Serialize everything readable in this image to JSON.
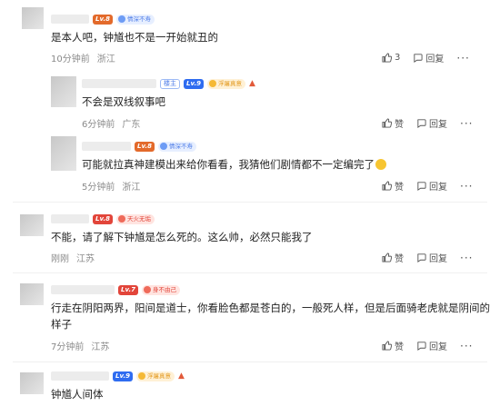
{
  "comments": [
    {
      "level": "Lv.8",
      "badge": "情深不寿",
      "text": "是本人吧，钟馗也不是一开始就丑的",
      "time": "10分钟前",
      "location": "浙江",
      "likes": "3",
      "reply_label": "回复"
    },
    {
      "host_tag": "楼主",
      "level": "Lv.9",
      "badge": "浮屠真意",
      "text": "不会是双线叙事吧",
      "time": "6分钟前",
      "location": "广东",
      "like_label": "赞",
      "reply_label": "回复"
    },
    {
      "level": "Lv.8",
      "badge": "情深不寿",
      "text": "可能就拉真神建模出来给你看看，我猜他们剧情都不一定编完了",
      "time": "5分钟前",
      "location": "浙江",
      "like_label": "赞",
      "reply_label": "回复"
    },
    {
      "level": "Lv.8",
      "badge": "天火无垢",
      "text": "不能，请了解下钟馗是怎么死的。这么帅，必然只能我了",
      "time": "刚刚",
      "location": "江苏",
      "like_label": "赞",
      "reply_label": "回复"
    },
    {
      "level": "Lv.7",
      "badge": "身不由己",
      "text_line1": "行走在阴阳两界，阳间是道士，你看脸色都是苍白的，一般死人样，但是后面骑老虎就是阴间的",
      "text_line2": "样子",
      "time": "7分钟前",
      "location": "江苏",
      "like_label": "赞",
      "reply_label": "回复"
    },
    {
      "level": "Lv.9",
      "badge": "浮屠真意",
      "text": "钟馗人间体"
    }
  ],
  "more_label": "···",
  "colors": {
    "blue_badge": "#4d7ce8",
    "yellow_badge": "#e39a20",
    "red_badge": "#e2453a"
  }
}
